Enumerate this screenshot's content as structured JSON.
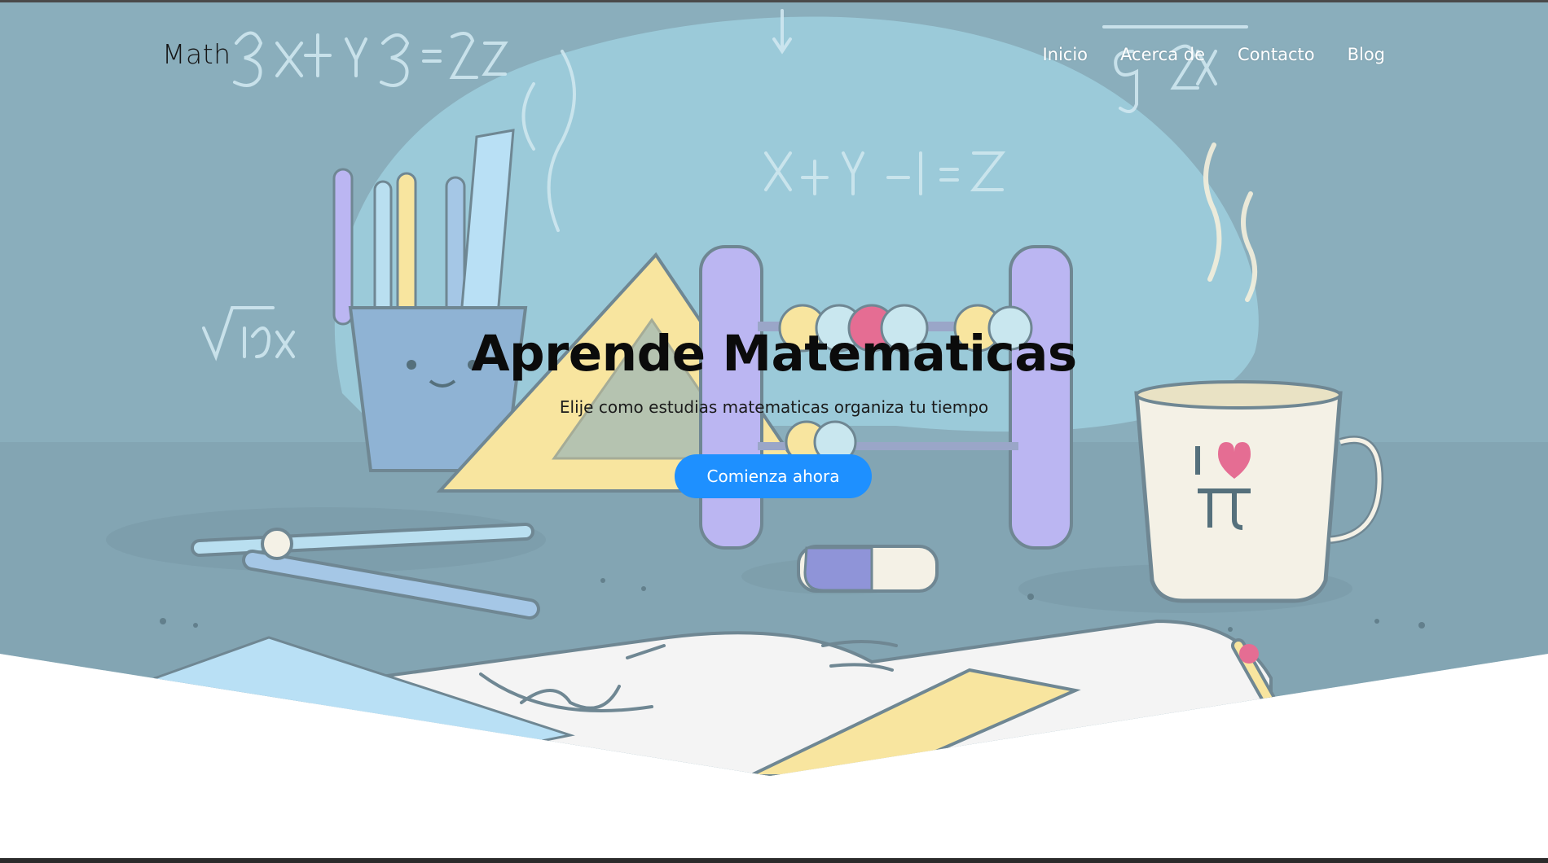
{
  "nav": {
    "brand": "Math",
    "links": [
      {
        "label": "Inicio"
      },
      {
        "label": "Acerca de"
      },
      {
        "label": "Contacto"
      },
      {
        "label": "Blog"
      }
    ]
  },
  "hero": {
    "title": "Aprende Matematicas",
    "subtitle": "Elije como estudias matematicas organiza tu tiempo",
    "cta_label": "Comienza ahora",
    "background_formulas": [
      "3x²+y²-3=2z",
      "x²+y²-1=Z",
      "√16x",
      "g 2x"
    ],
    "mug_text": "I ♥ π"
  },
  "colors": {
    "hero_bg": "#8aaebc",
    "blob": "#9ccddb",
    "cta": "#1e90ff",
    "accent_purple": "#bbb6f2",
    "accent_yellow": "#f8e59f",
    "accent_pink": "#e56d93"
  }
}
